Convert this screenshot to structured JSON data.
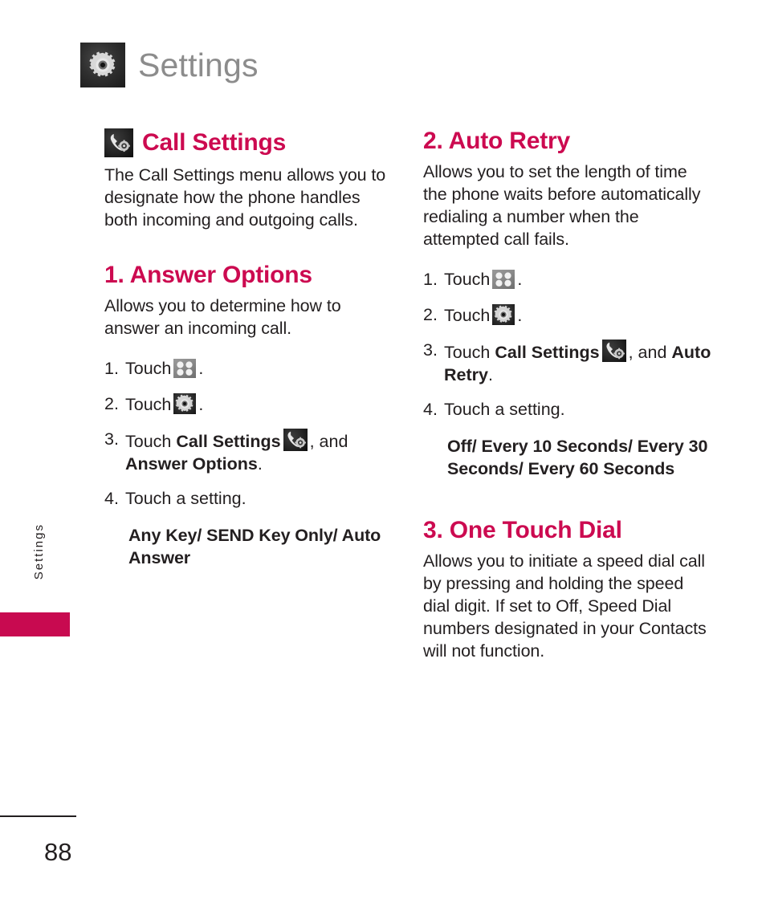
{
  "header": {
    "title": "Settings",
    "icon": "gear-icon"
  },
  "side_tab": {
    "label": "Settings"
  },
  "footer": {
    "page_number": "88"
  },
  "colors": {
    "accent_magenta": "#cc0a50",
    "tab_magenta": "#c80a50",
    "header_grey": "#8c8c8c",
    "body_black": "#231f20"
  },
  "left_column": {
    "call_settings": {
      "icon": "call-settings-icon",
      "title": "Call Settings",
      "body": "The Call Settings menu allows you to designate how the phone handles both incoming and outgoing calls."
    },
    "answer_options": {
      "title": "1. Answer Options",
      "body": "Allows you to determine how to answer an incoming call.",
      "steps": {
        "s1_num": "1.",
        "s1_text": "Touch",
        "s1_icon": "menu-grid-icon",
        "s1_tail": ".",
        "s2_num": "2.",
        "s2_text": "Touch",
        "s2_icon": "gear-icon",
        "s2_tail": ".",
        "s3_num": "3.",
        "s3_text": "Touch",
        "s3_bold1": "Call Settings",
        "s3_icon": "call-settings-icon",
        "s3_mid": ", and",
        "s3_bold2": "Answer Options",
        "s3_tail": ".",
        "s4_num": "4.",
        "s4_text": "Touch a setting."
      },
      "options": "Any Key/ SEND Key Only/ Auto Answer"
    }
  },
  "right_column": {
    "auto_retry": {
      "title": "2. Auto Retry",
      "body": "Allows you to set the length of time the phone waits before automatically redialing a number when the attempted call fails.",
      "steps": {
        "s1_num": "1.",
        "s1_text": "Touch",
        "s1_icon": "menu-grid-icon",
        "s1_tail": ".",
        "s2_num": "2.",
        "s2_text": "Touch",
        "s2_icon": "gear-icon",
        "s2_tail": ".",
        "s3_num": "3.",
        "s3_text": "Touch",
        "s3_bold1": "Call Settings",
        "s3_icon": "call-settings-icon",
        "s3_mid": ", and",
        "s3_bold2": "Auto Retry",
        "s3_tail": ".",
        "s4_num": "4.",
        "s4_text": "Touch a setting."
      },
      "options": "Off/ Every 10 Seconds/ Every 30 Seconds/ Every 60 Seconds"
    },
    "one_touch_dial": {
      "title": "3. One Touch Dial",
      "body": "Allows you to initiate a speed dial call by pressing and holding the speed dial digit. If set to Off, Speed Dial numbers designated in your Contacts will not function."
    }
  }
}
